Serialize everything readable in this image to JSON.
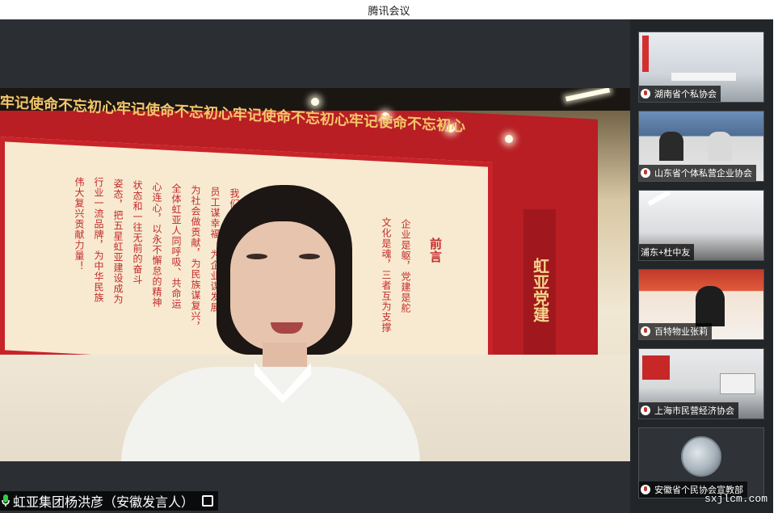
{
  "window": {
    "title": "腾讯会议"
  },
  "main_video": {
    "speaker_name": "虹亚集团杨洪彦（安徽发言人）",
    "banner_slogan": "牢记使命不忘初心",
    "emblem_text": "虹亚党建",
    "wall_heading": "前言",
    "wall_columns": [
      "伟大复兴贡献力量！",
      "行业一流品牌，为中华民族",
      "姿态，把五星虹亚建设成为",
      "状态和一往无前的奋斗",
      "心连心，以永不懈怠的精神",
      "全体虹亚人同呼吸、共命运",
      "为社会做贡献，为民族谋复兴，",
      "员工谋幸福，为企业谋发展",
      "我们的初心和使命就是为",
      "文化是魂，三者互为支撑",
      "企业是躯，党建是舵"
    ]
  },
  "participants": [
    {
      "name": "湖南省个私协会"
    },
    {
      "name": "山东省个体私营企业协会"
    },
    {
      "name": "浦东+杜中友"
    },
    {
      "name": "百特物业张莉"
    },
    {
      "name": "上海市民营经济协会"
    },
    {
      "name": "安徽省个民协会宣教部"
    }
  ],
  "watermark": "sxjlcm.com",
  "colors": {
    "party_red": "#c32b2b",
    "sidebar_bg": "#232629"
  }
}
